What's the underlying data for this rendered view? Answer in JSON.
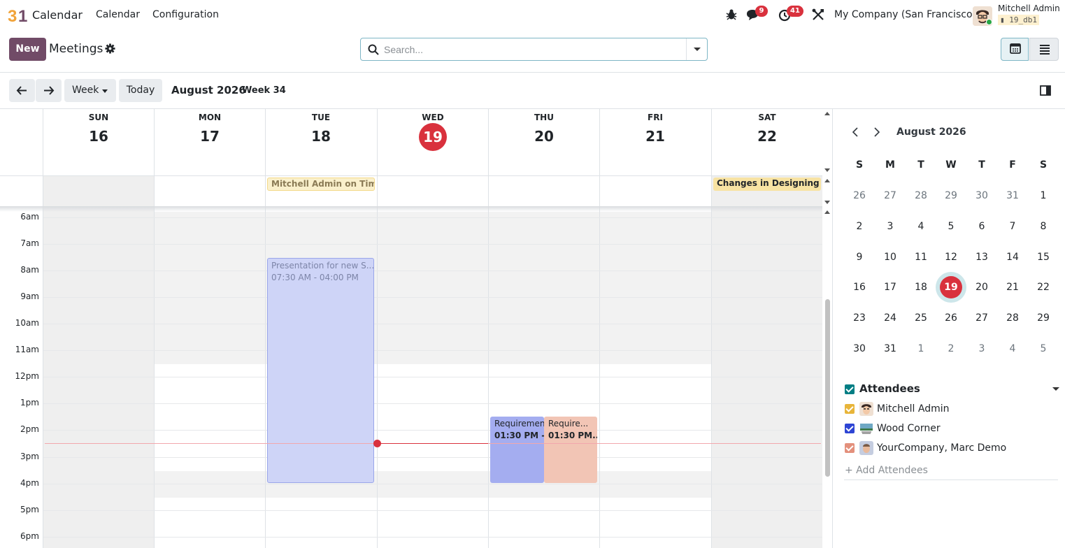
{
  "navbar": {
    "app_logo": "31",
    "app_name": "Calendar",
    "menus": [
      "Calendar",
      "Configuration"
    ],
    "icons": [
      "bug-icon",
      "chat-icon",
      "clock-icon",
      "tools-icon"
    ],
    "messages_count": "9",
    "activities_count": "41",
    "company": "My Company (San Francisco)",
    "user_name": "Mitchell Admin",
    "db_name": "19_db1"
  },
  "control_panel": {
    "new_label": "New",
    "title": "Meetings",
    "search_placeholder": "Search..."
  },
  "toolbar": {
    "prev_icon": "arrow-left-icon",
    "next_icon": "arrow-right-icon",
    "scale_label": "Week",
    "today_label": "Today",
    "period_title": "August 2026",
    "week_label": "Week 34"
  },
  "week": {
    "days": [
      {
        "name": "SUN",
        "num": "16"
      },
      {
        "name": "MON",
        "num": "17"
      },
      {
        "name": "TUE",
        "num": "18"
      },
      {
        "name": "WED",
        "num": "19"
      },
      {
        "name": "THU",
        "num": "20"
      },
      {
        "name": "FRI",
        "num": "21"
      },
      {
        "name": "SAT",
        "num": "22"
      }
    ],
    "today_index": 3,
    "hours": [
      "6am",
      "7am",
      "8am",
      "9am",
      "10am",
      "11am",
      "12pm",
      "1pm",
      "2pm",
      "3pm",
      "4pm",
      "5pm",
      "6pm"
    ],
    "allday_events": [
      {
        "title": "Mitchell Admin on Tim...",
        "day": "TUE"
      },
      {
        "title": "Changes in Designing",
        "day": "SAT"
      }
    ],
    "events": [
      {
        "title": "Presentation for new S...",
        "time": "07:30 AM - 04:00 PM",
        "day": "TUE"
      },
      {
        "title": "Requirement",
        "time": "01:30 PM - 0",
        "day": "THU"
      },
      {
        "title": "Require...",
        "time": "01:30 PM...",
        "day": "THU"
      }
    ]
  },
  "mini_calendar": {
    "title": "August 2026",
    "dow": [
      "S",
      "M",
      "T",
      "W",
      "T",
      "F",
      "S"
    ],
    "weeks": [
      [
        "26",
        "27",
        "28",
        "29",
        "30",
        "31",
        "1"
      ],
      [
        "2",
        "3",
        "4",
        "5",
        "6",
        "7",
        "8"
      ],
      [
        "9",
        "10",
        "11",
        "12",
        "13",
        "14",
        "15"
      ],
      [
        "16",
        "17",
        "18",
        "19",
        "20",
        "21",
        "22"
      ],
      [
        "23",
        "24",
        "25",
        "26",
        "27",
        "28",
        "29"
      ],
      [
        "30",
        "31",
        "1",
        "2",
        "3",
        "4",
        "5"
      ]
    ],
    "today": "19"
  },
  "attendees": {
    "header": "Attendees",
    "items": [
      {
        "name": "Mitchell Admin",
        "color": "#e8b53a"
      },
      {
        "name": "Wood Corner",
        "color": "#2e45d4"
      },
      {
        "name": "YourCompany, Marc Demo",
        "color": "#e3907c"
      }
    ],
    "add_label": "+ Add Attendees"
  },
  "colors": {
    "brand": "#714b67",
    "today": "#d9313d",
    "event_purple": "#cdd4f7",
    "event_blue": "#a3aef0",
    "event_salmon": "#f2c6b6",
    "allday_yellow": "#f9e6b3"
  }
}
